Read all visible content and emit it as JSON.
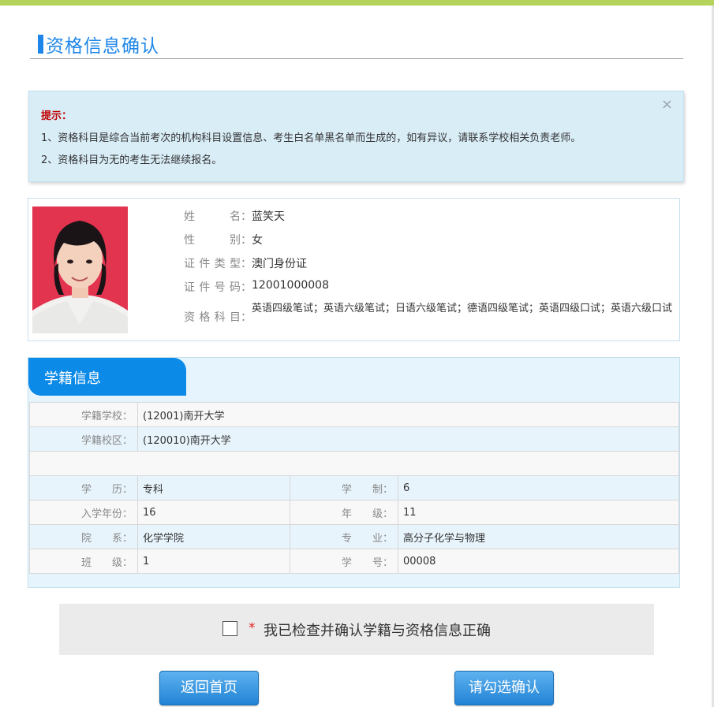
{
  "page": {
    "title": "资格信息确认"
  },
  "tip": {
    "close": "×",
    "title": "提示：",
    "lines": [
      "1、资格科目是综合当前考次的机构科目设置信息、考生白名单黑名单而生成的，如有异议，请联系学校相关负责老师。",
      "2、资格科目为无的考生无法继续报名。"
    ]
  },
  "candidate": {
    "labels": {
      "name": "姓名",
      "gender": "性别",
      "id_type": "证件类型",
      "id_number": "证件号码",
      "subjects": "资格科目"
    },
    "colon": "：",
    "name": "蓝笑天",
    "gender": "女",
    "id_type": "澳门身份证",
    "id_number": "12001000008",
    "subjects": "英语四级笔试；英语六级笔试；日语六级笔试；德语四级笔试；英语四级口试；英语六级口试"
  },
  "school": {
    "tab": "学籍信息",
    "rows": [
      {
        "label": "学籍学校：",
        "value": "(12001)南开大学"
      },
      {
        "label": "学籍校区：",
        "value": "(120010)南开大学"
      }
    ],
    "grid": [
      {
        "l1": "学　　历：",
        "v1": "专科",
        "l2": "学　　制：",
        "v2": "6"
      },
      {
        "l1": "入学年份：",
        "v1": "16",
        "l2": "年　　级：",
        "v2": "11"
      },
      {
        "l1": "院　　系：",
        "v1": "化学学院",
        "l2": "专　　业：",
        "v2": "高分子化学与物理"
      },
      {
        "l1": "班　　级：",
        "v1": "1",
        "l2": "学　　号：",
        "v2": "00008"
      }
    ]
  },
  "confirm": {
    "star": "*",
    "text": "我已检查并确认学籍与资格信息正确"
  },
  "buttons": {
    "home": "返回首页",
    "confirm": "请勾选确认"
  },
  "colors": {
    "accent": "#1e86e8",
    "top_bar": "#b5d35a",
    "tip_bg": "#d9edf7",
    "tip_title": "#c00000"
  }
}
